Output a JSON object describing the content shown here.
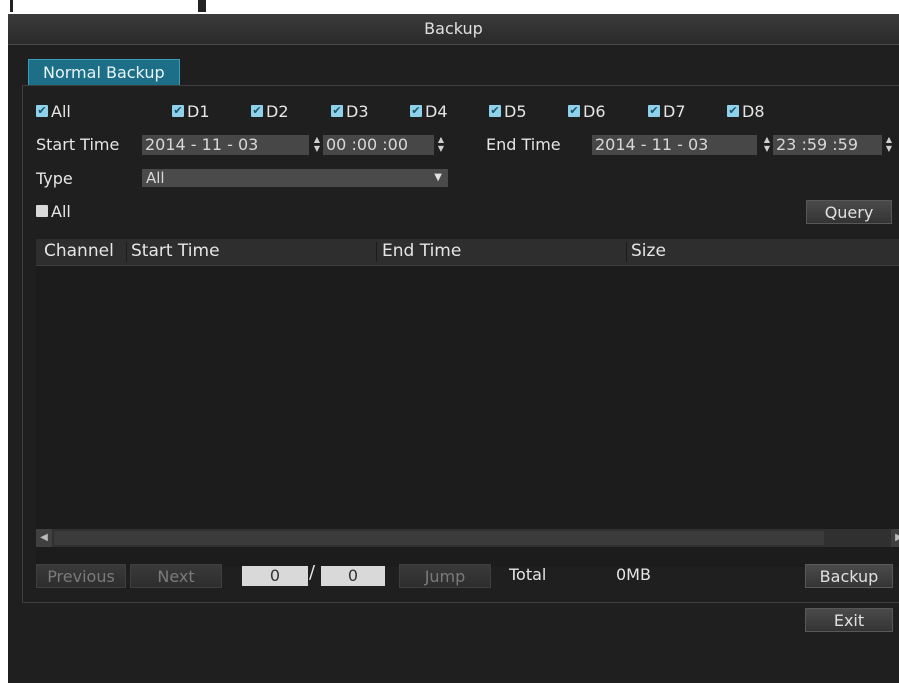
{
  "window": {
    "title": "Backup"
  },
  "tab": {
    "label": "Normal Backup"
  },
  "channels": {
    "all_label": "All",
    "items": [
      "D1",
      "D2",
      "D3",
      "D4",
      "D5",
      "D6",
      "D7",
      "D8"
    ]
  },
  "time": {
    "start_label": "Start Time",
    "start_date": "2014 -  11 -  03",
    "start_time": "00 :00 :00",
    "end_label": "End Time",
    "end_date": "2014 -  11 -  03",
    "end_time": "23 :59 :59"
  },
  "type": {
    "label": "Type",
    "value": "All"
  },
  "select_all": {
    "label": "All"
  },
  "buttons": {
    "query": "Query",
    "previous": "Previous",
    "next": "Next",
    "jump": "Jump",
    "backup": "Backup",
    "exit": "Exit"
  },
  "table": {
    "columns": [
      "Channel",
      "Start Time",
      "End Time",
      "Size"
    ],
    "rows": []
  },
  "pager": {
    "current": "0",
    "separator": "/",
    "total_pages": "0"
  },
  "summary": {
    "total_label": "Total",
    "total_value": "0MB"
  },
  "colors": {
    "accent": "#1d6f87",
    "background": "#1f1f1f"
  }
}
